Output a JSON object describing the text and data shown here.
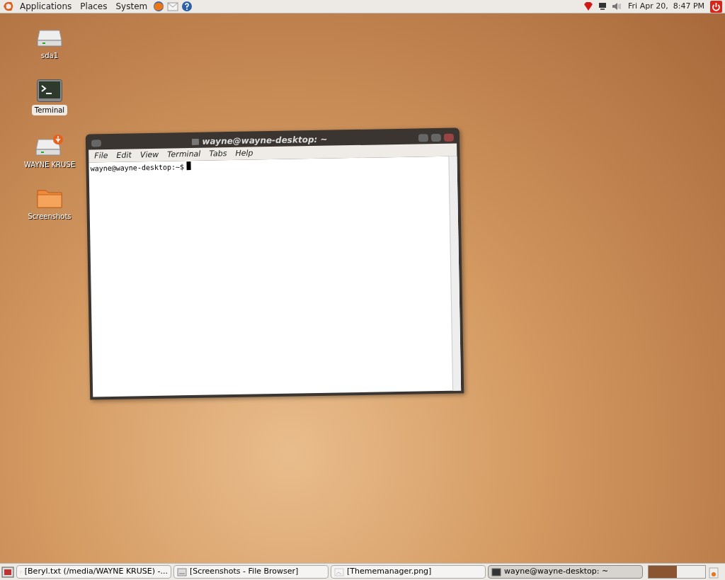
{
  "top_panel": {
    "menus": [
      "Applications",
      "Places",
      "System"
    ],
    "clock": "Fri Apr 20,  8:47 PM"
  },
  "desktop_icons": [
    {
      "kind": "drive",
      "label": "sda1",
      "selected": false
    },
    {
      "kind": "terminal",
      "label": "Terminal",
      "selected": true
    },
    {
      "kind": "usb",
      "label": "WAYNE KRUSE",
      "selected": false
    },
    {
      "kind": "folder",
      "label": "Screenshots",
      "selected": false
    }
  ],
  "terminal_window": {
    "title": "wayne@wayne-desktop: ~",
    "menu": [
      "File",
      "Edit",
      "View",
      "Terminal",
      "Tabs",
      "Help"
    ],
    "prompt": "wayne@wayne-desktop:~$"
  },
  "taskbar": {
    "tasks": [
      {
        "kind": "text",
        "label": "[Beryl.txt (/media/WAYNE KRUSE) -...",
        "selected": false
      },
      {
        "kind": "files",
        "label": "[Screenshots - File Browser]",
        "selected": false
      },
      {
        "kind": "image",
        "label": "[Thememanager.png]",
        "selected": false
      },
      {
        "kind": "terminal",
        "label": "wayne@wayne-desktop: ~",
        "selected": true
      }
    ],
    "workspaces": [
      {
        "selected": true
      },
      {
        "selected": false
      }
    ]
  }
}
